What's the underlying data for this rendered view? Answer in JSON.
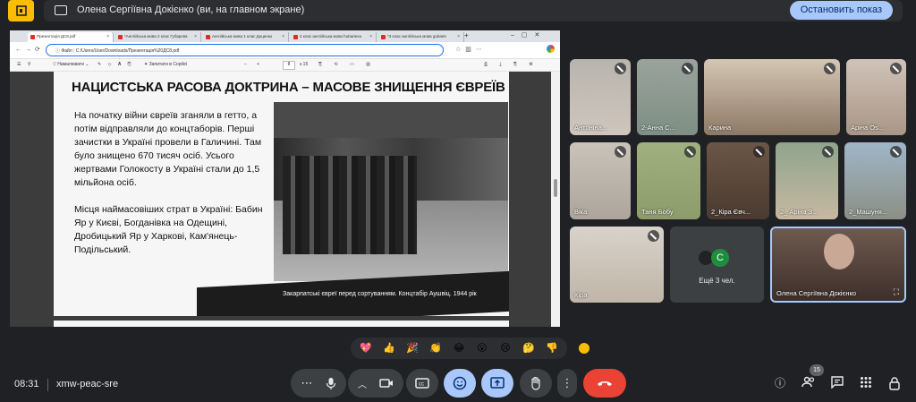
{
  "presentation": {
    "banner": "Олена Сергіївна Докієнко (ви, на главном экране)",
    "stop_label": "Остановить показ"
  },
  "browser": {
    "tabs": [
      "Презентація ДС8.pdf",
      "*Англійська мова 2 клас Губарєва",
      "Англійська мова 1 клас Доценко",
      "4 клас англійська мова hubarieva",
      "*3 клас англійська мова gubarie"
    ],
    "new_tab": "+",
    "file_label": "Файл",
    "url": "C:/Users/User/Downloads/Презентація%20ДС8.pdf",
    "toolbar_draw": "Намалювати",
    "toolbar_copilot": "Запитати в Copilot",
    "page_current": "8",
    "page_total": "з 15"
  },
  "slide": {
    "title": "НАЦИСТСЬКА РАСОВА ДОКТРИНА – МАСОВЕ ЗНИЩЕННЯ ЄВРЕЇВ",
    "paragraph1": "На початку війни євреїв зганяли в гетто, а потім відправляли до концтаборів. Перші зачистки в Україні провели в Галичині. Там було знищено 670 тисяч осіб. Усього жертвами Голокосту в Україні стали до 1,5 мільйона осіб.",
    "paragraph2": "Місця наймасовіших страт в Україні: Бабин Яр у Києві, Богданівка на Одещині, Дробицький Яр у Харкові, Кам'янець-Подільський.",
    "caption": "Закарпатські євреї перед сортуванням. Концтабір Аушвіц. 1944 рік"
  },
  "participants": [
    {
      "name": "Антоніна..."
    },
    {
      "name": "2-Анна С..."
    },
    {
      "name": "Карина"
    },
    {
      "name": "Аріна Os..."
    },
    {
      "name": "Віка"
    },
    {
      "name": "Таня Бобу"
    },
    {
      "name": "2_Кіра Євч..."
    },
    {
      "name": "2_ Аріна З..."
    },
    {
      "name": "2_Машуня..."
    },
    {
      "name": "Кіра"
    },
    {
      "name": "Олена Сергіївна Докієнко"
    }
  ],
  "more_tile": {
    "label": "Ещё 3 чел.",
    "avatar_letter": "С"
  },
  "reactions": [
    "💖",
    "👍",
    "🎉",
    "👏",
    "😂",
    "😮",
    "😢",
    "🤔",
    "👎"
  ],
  "bottom": {
    "time": "08:31",
    "meeting_code": "xmw-peac-sre",
    "people_count": "15"
  },
  "colors": {
    "accent": "#a8c7fa",
    "end_call": "#ea4335",
    "background": "#202124"
  }
}
